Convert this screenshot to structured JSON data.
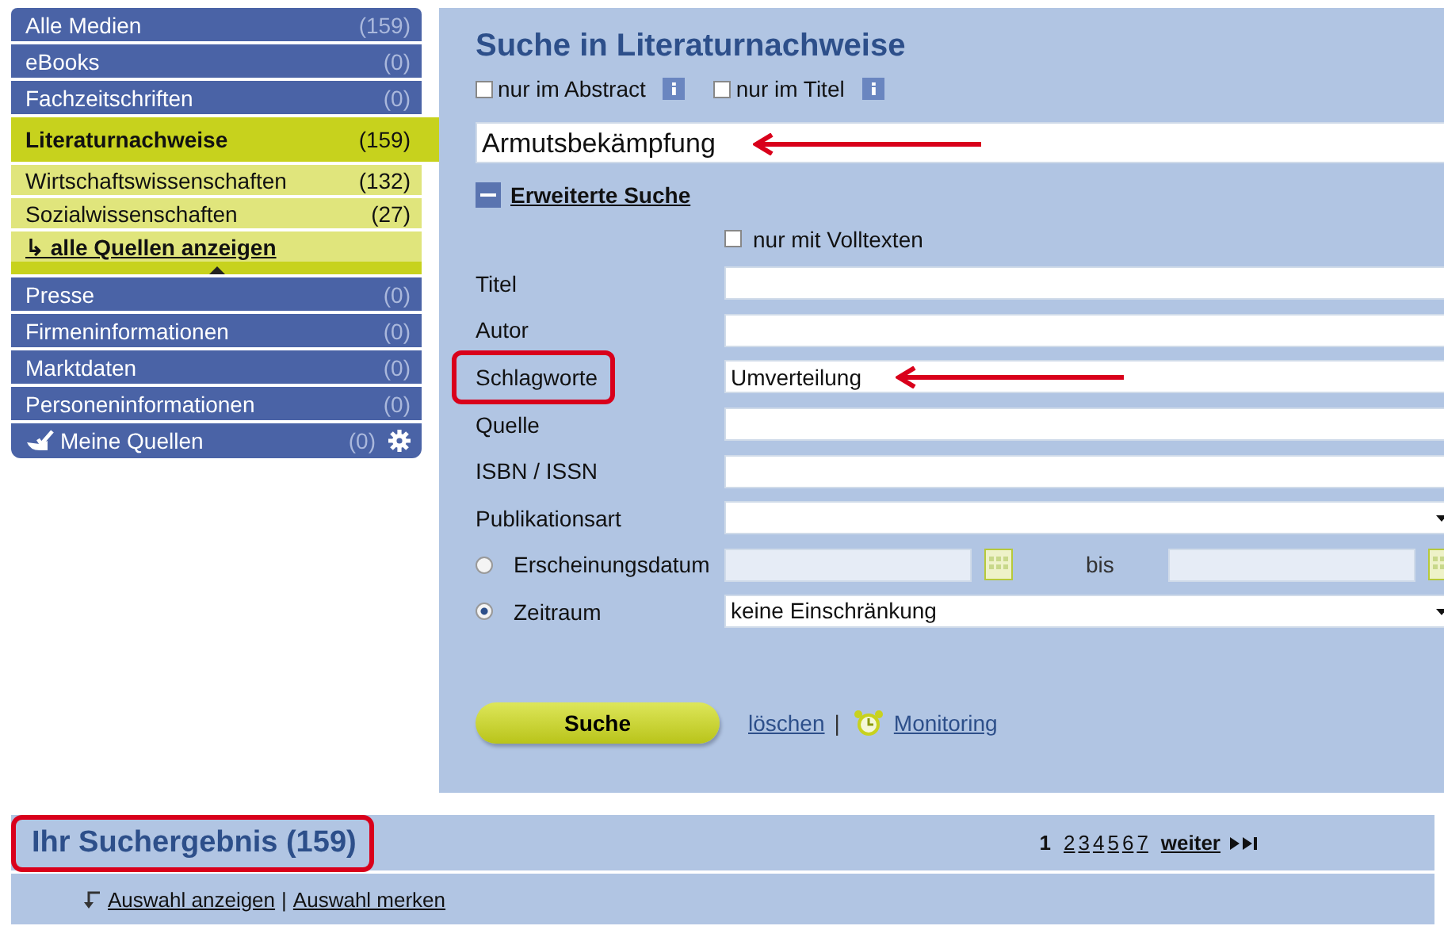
{
  "sidebar": {
    "items": [
      {
        "label": "Alle Medien",
        "count": "(159)",
        "selected": false
      },
      {
        "label": "eBooks",
        "count": "(0)",
        "selected": false
      },
      {
        "label": "Fachzeitschriften",
        "count": "(0)",
        "selected": false
      },
      {
        "label": "Literaturnachweise",
        "count": "(159)",
        "selected": true,
        "children": [
          {
            "label": "Wirtschaftswissenschaften",
            "count": "(132)"
          },
          {
            "label": "Sozialwissenschaften",
            "count": "(27)"
          }
        ],
        "show_all": "↳ alle Quellen anzeigen"
      },
      {
        "label": "Presse",
        "count": "(0)",
        "selected": false
      },
      {
        "label": "Firmeninformationen",
        "count": "(0)",
        "selected": false
      },
      {
        "label": "Marktdaten",
        "count": "(0)",
        "selected": false
      },
      {
        "label": "Personeninformationen",
        "count": "(0)",
        "selected": false
      }
    ],
    "my_sources": {
      "label": "Meine Quellen",
      "count": "(0)"
    }
  },
  "search": {
    "title": "Suche in Literaturnachweise",
    "options": [
      {
        "label": "nur im Abstract",
        "checked": false
      },
      {
        "label": "nur im Titel",
        "checked": false
      }
    ],
    "query": {
      "value": "Armutsbekämpfung",
      "arrow": true
    },
    "advanced_toggle": {
      "label": "Erweiterte Suche",
      "expanded": true
    },
    "fulltext": {
      "label": "nur mit Volltexten",
      "checked": false
    },
    "fields": [
      {
        "kind": "text",
        "label": "Titel",
        "highlighted": false,
        "arrow": false
      },
      {
        "kind": "text",
        "label": "Autor",
        "highlighted": false,
        "arrow": false
      },
      {
        "kind": "text",
        "label": "Schlagworte",
        "value": "Umverteilung",
        "highlighted": true,
        "arrow": true
      },
      {
        "kind": "text",
        "label": "Quelle",
        "highlighted": false,
        "arrow": false
      },
      {
        "kind": "text",
        "label": "ISBN / ISSN",
        "highlighted": false,
        "arrow": false
      },
      {
        "kind": "select",
        "label": "Publikationsart",
        "highlighted": false,
        "arrow": false
      },
      {
        "kind": "daterange",
        "label": "Erscheinungsdatum",
        "selected": false,
        "separator": "bis",
        "highlighted": false,
        "arrow": false
      },
      {
        "kind": "radioselect",
        "label": "Zeitraum",
        "selected": true,
        "value": "keine Einschränkung",
        "highlighted": false,
        "arrow": false
      }
    ],
    "submit": "Suche",
    "clear": "löschen",
    "divider": "|",
    "monitoring": "Monitoring"
  },
  "results": {
    "title": "Ihr Suchergebnis (159)",
    "highlighted": true,
    "pages": [
      {
        "label": "1",
        "selected": true
      },
      {
        "label": "2",
        "selected": false
      },
      {
        "label": "3",
        "selected": false
      },
      {
        "label": "4",
        "selected": false
      },
      {
        "label": "5",
        "selected": false
      },
      {
        "label": "6",
        "selected": false
      },
      {
        "label": "7",
        "selected": false
      }
    ],
    "next": "weiter",
    "actions": [
      "Auswahl anzeigen",
      "Auswahl merken"
    ],
    "actions_divider": "|"
  }
}
